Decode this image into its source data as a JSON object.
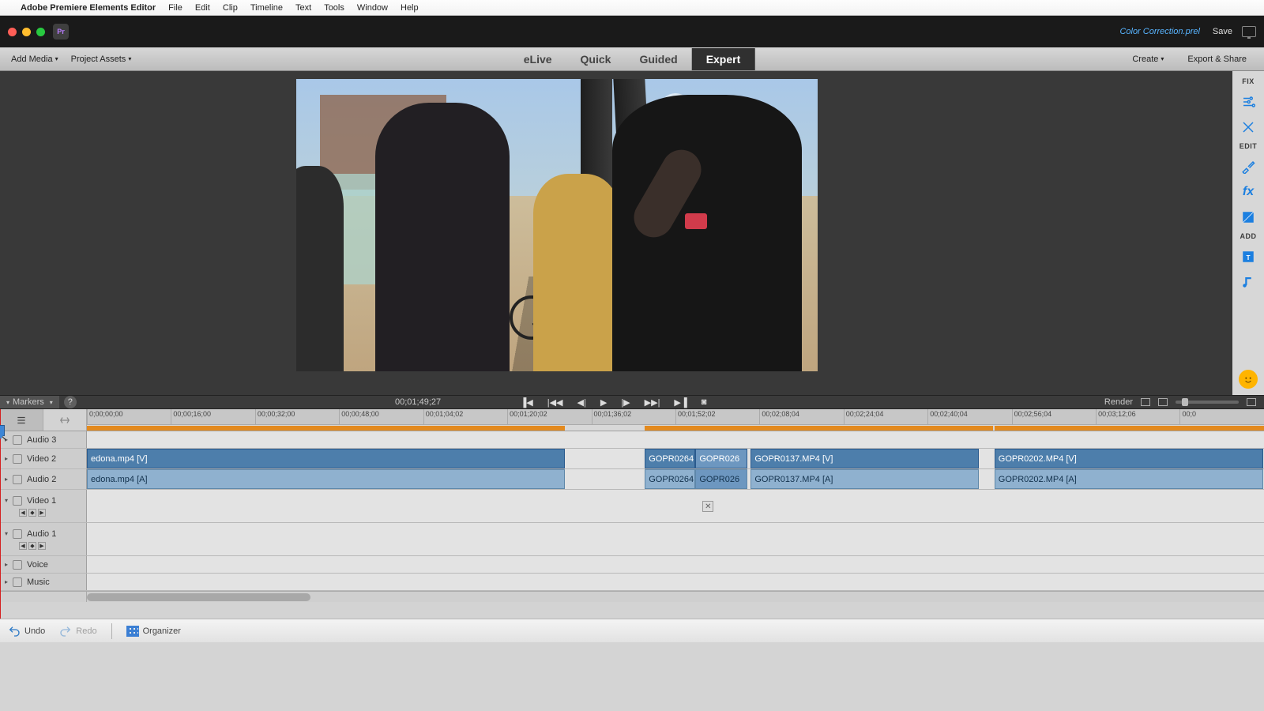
{
  "menubar": {
    "app": "Adobe Premiere Elements Editor",
    "items": [
      "File",
      "Edit",
      "Clip",
      "Timeline",
      "Text",
      "Tools",
      "Window",
      "Help"
    ]
  },
  "titlebar": {
    "project": "Color Correction.prel",
    "save": "Save"
  },
  "toolbar": {
    "add_media": "Add Media",
    "project_assets": "Project Assets",
    "modes": {
      "elive": "eLive",
      "quick": "Quick",
      "guided": "Guided",
      "expert": "Expert"
    },
    "create": "Create",
    "export_share": "Export & Share"
  },
  "rightpanel": {
    "fix": "FIX",
    "edit": "EDIT",
    "add": "ADD"
  },
  "transport": {
    "markers": "Markers",
    "timecode": "00;01;49;27",
    "render": "Render"
  },
  "ruler_ticks": [
    "0;00;00;00",
    "00;00;16;00",
    "00;00;32;00",
    "00;00;48;00",
    "00;01;04;02",
    "00;01;20;02",
    "00;01;36;02",
    "00;01;52;02",
    "00;02;08;04",
    "00;02;24;04",
    "00;02;40;04",
    "00;02;56;04",
    "00;03;12;06",
    "00;0"
  ],
  "tracks": {
    "audio3": "Audio 3",
    "video2": "Video 2",
    "audio2": "Audio 2",
    "video1": "Video 1",
    "audio1": "Audio 1",
    "voice": "Voice",
    "music": "Music"
  },
  "clips": {
    "edona_v": "edona.mp4 [V]",
    "edona_a": "edona.mp4 [A]",
    "g264_v": "GOPR0264.",
    "g264_a": "GOPR0264.",
    "g026_v": "GOPR026",
    "g026_a": "GOPR026",
    "g0137_v": "GOPR0137.MP4 [V]",
    "g0137_a": "GOPR0137.MP4 [A]",
    "g0202_v": "GOPR0202.MP4 [V]",
    "g0202_a": "GOPR0202.MP4 [A]"
  },
  "footer": {
    "undo": "Undo",
    "redo": "Redo",
    "organizer": "Organizer"
  },
  "colors": {
    "accent": "#3d86d6",
    "clip": "#4d7eab",
    "clip_light": "#8fb1cf",
    "render_bar": "#e38a1f"
  }
}
